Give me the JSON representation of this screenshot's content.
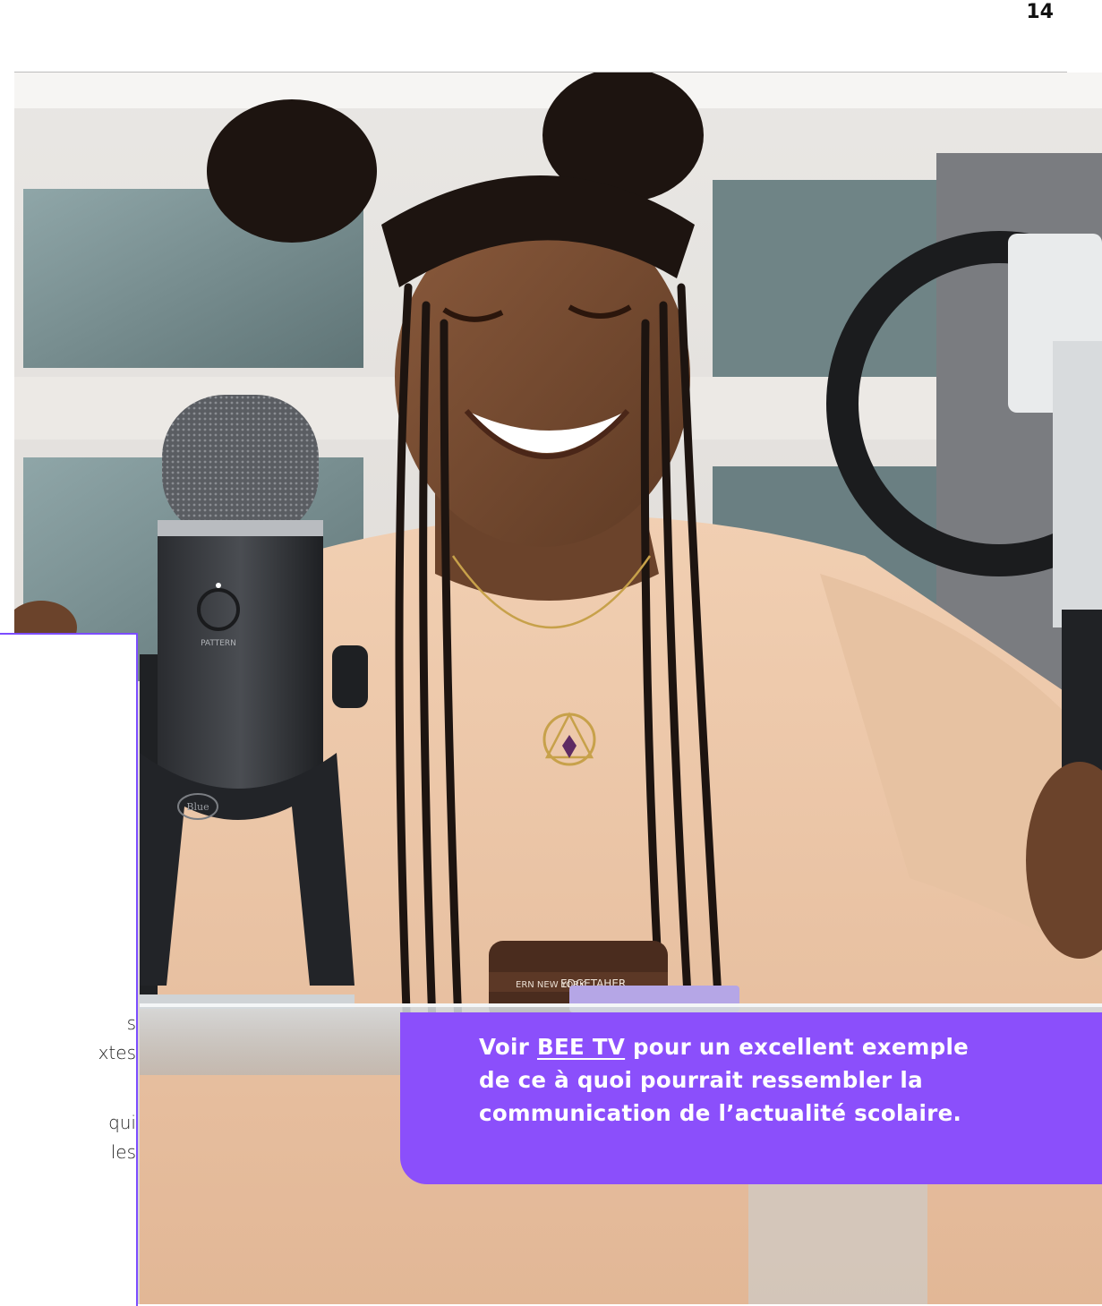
{
  "page": {
    "number": "14"
  },
  "photo": {
    "microphone_label": "PATTERN",
    "microphone_brand": "Blue",
    "jar_text_left": "ERN NEW YORK",
    "jar_text_brand": "EDGETAHER"
  },
  "left_text_fragments": [
    "s",
    "xtes",
    "qui",
    "les"
  ],
  "callout": {
    "prefix": "Voir ",
    "link_text": "BEE TV",
    "line1_rest": " pour un excellent exemple",
    "line2": "de ce à quoi pourrait ressembler la",
    "line3": "communication de l’actualité scolaire.",
    "background_color": "#8B4FFB"
  },
  "colors": {
    "accent": "#7C4DFF",
    "rule": "#BDBDBD"
  }
}
